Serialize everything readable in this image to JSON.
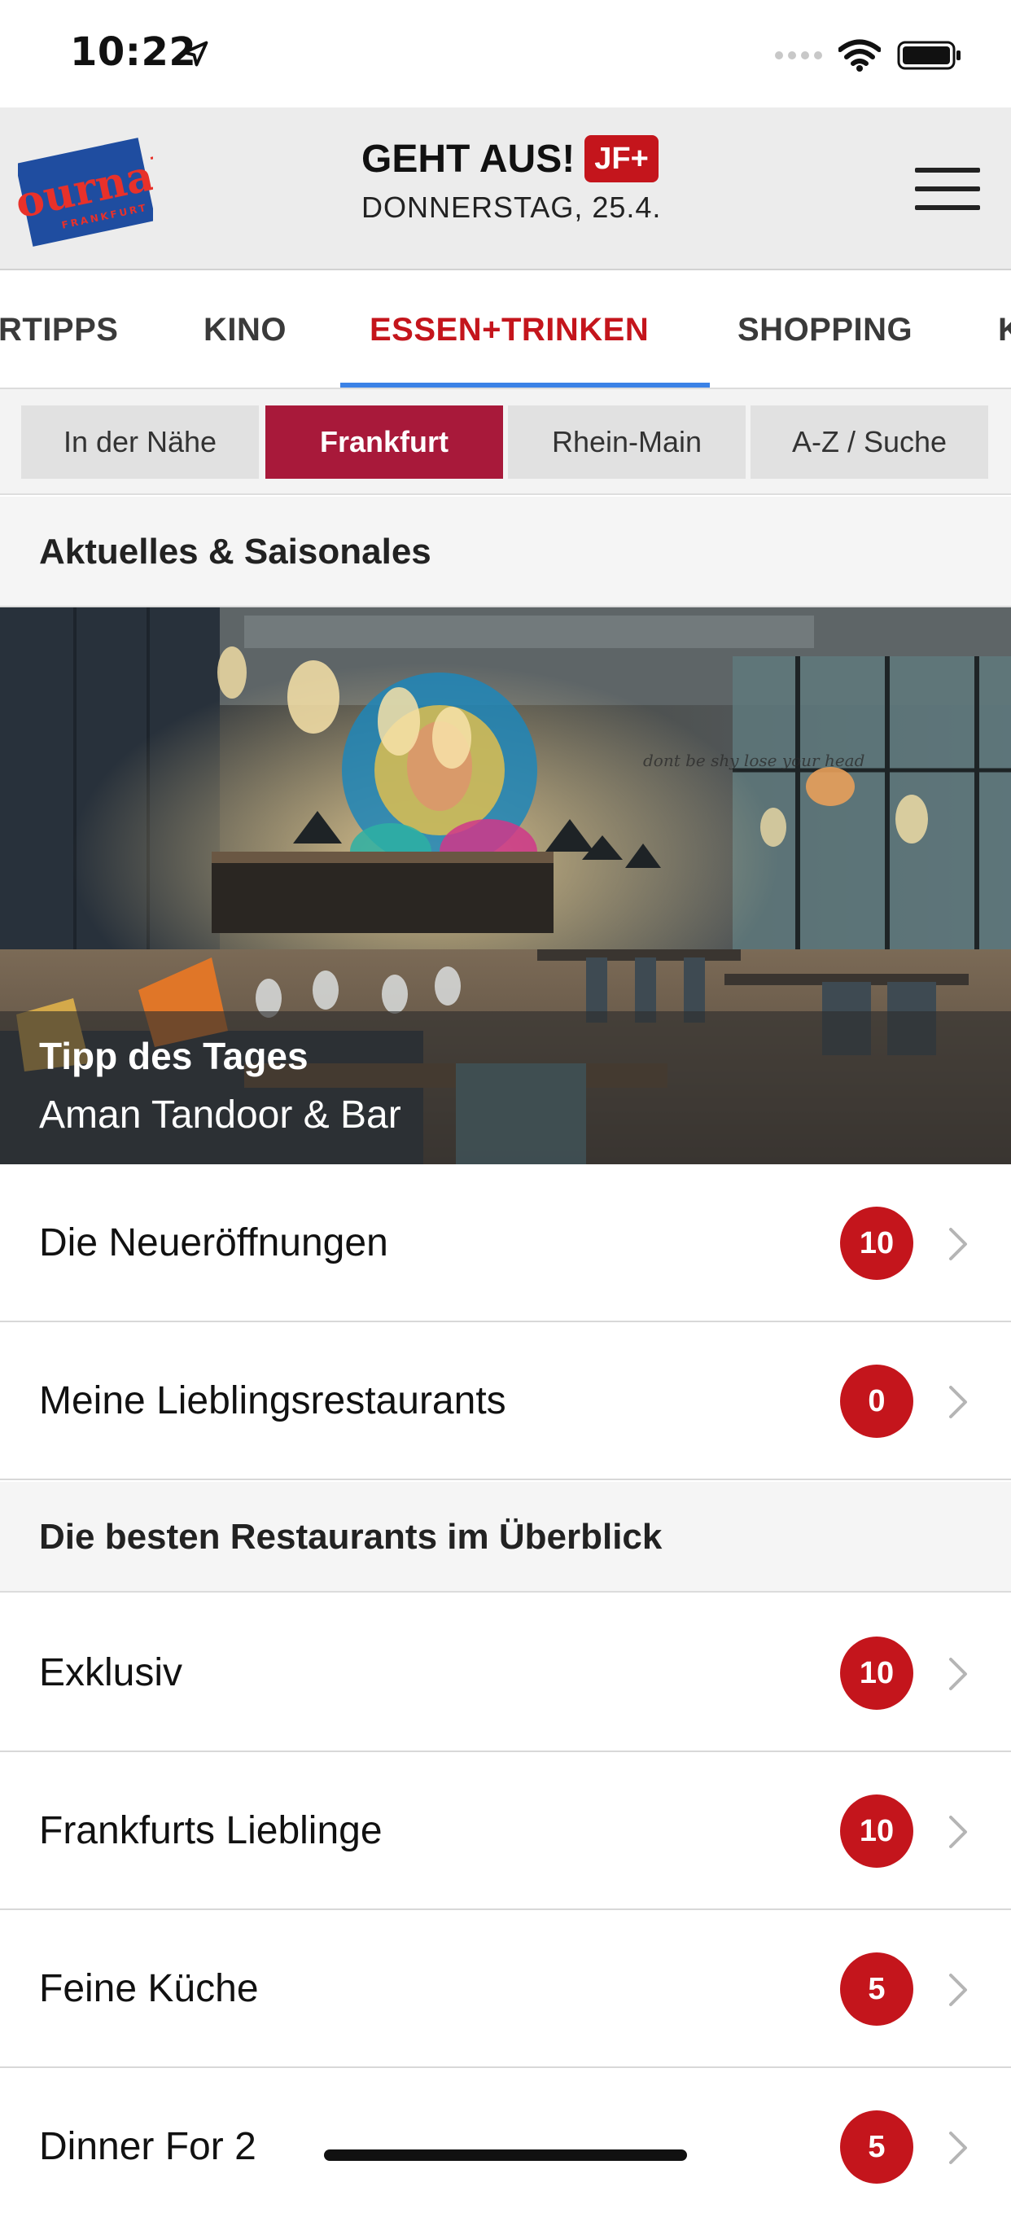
{
  "status_bar": {
    "time": "10:22"
  },
  "header": {
    "logo_text": "journal",
    "logo_subtext": "FRANKFURT",
    "title": "GEHT AUS!",
    "badge": "JF+",
    "date": "DONNERSTAG, 25.4."
  },
  "category_tabs": [
    {
      "label": "RTIPPS",
      "active": false
    },
    {
      "label": "KINO",
      "active": false
    },
    {
      "label": "ESSEN+TRINKEN",
      "active": true
    },
    {
      "label": "SHOPPING",
      "active": false
    },
    {
      "label": "K",
      "active": false
    }
  ],
  "segments": [
    {
      "label": "In der Nähe",
      "active": false
    },
    {
      "label": "Frankfurt",
      "active": true
    },
    {
      "label": "Rhein-Main",
      "active": false
    },
    {
      "label": "A-Z / Suche",
      "active": false
    }
  ],
  "section1": {
    "title": "Aktuelles & Saisonales"
  },
  "hero": {
    "kicker": "Tipp des Tages",
    "title": "Aman Tandoor & Bar",
    "wall_text": "dont be shy lose your head"
  },
  "rows_a": [
    {
      "label": "Die Neueröffnungen",
      "count": "10"
    },
    {
      "label": "Meine Lieblingsrestaurants",
      "count": "0"
    }
  ],
  "section2": {
    "title": "Die besten Restaurants im Überblick"
  },
  "rows_b": [
    {
      "label": "Exklusiv",
      "count": "10"
    },
    {
      "label": "Frankfurts Lieblinge",
      "count": "10"
    },
    {
      "label": "Feine Küche",
      "count": "5"
    },
    {
      "label": "Dinner For 2",
      "count": "5"
    }
  ],
  "colors": {
    "accent_red": "#c4151c",
    "segment_active": "#a8193a",
    "tab_underline": "#3b82e6"
  }
}
